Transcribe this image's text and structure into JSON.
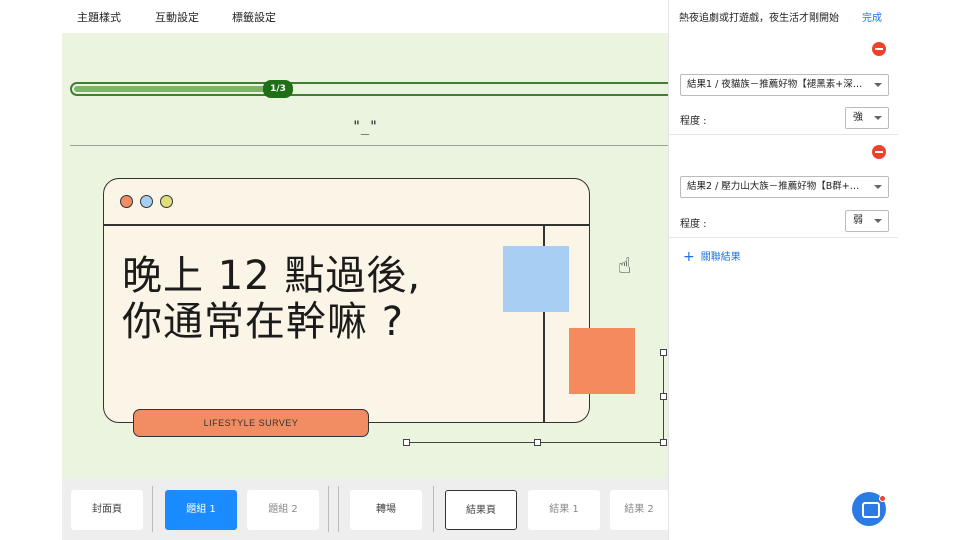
{
  "menu": {
    "items": [
      "主題樣式",
      "互動設定",
      "標籤設定"
    ]
  },
  "canvas": {
    "progress": {
      "label": "1/3",
      "fraction": 0.3333
    },
    "subtitle": "\"_\"",
    "headline_line1": "晚上 12 點過後,",
    "headline_line2": "你通常在幹嘛 ?",
    "pill_label": "LIFESTYLE SURVEY",
    "dot_colors": [
      "#f28c63",
      "#a8cef3",
      "#dede7a"
    ]
  },
  "pages": [
    {
      "label": "封面頁"
    },
    {
      "label": "題組 1"
    },
    {
      "label": "題組 2"
    },
    {
      "label": "轉場"
    },
    {
      "label": "結果頁"
    },
    {
      "label": "結果 1"
    },
    {
      "label": "結果 2"
    }
  ],
  "panel": {
    "title": "熱夜追劇或打遊戲，夜生活才剛開始",
    "done_label": "完成",
    "results": [
      {
        "result_value": "結果1 / 夜貓族－推薦好物【褪黑素+深…",
        "degree_label": "程度 :",
        "degree_value": "強"
      },
      {
        "result_value": "結果2 / 壓力山大族－推薦好物【B群+…",
        "degree_label": "程度 :",
        "degree_value": "弱"
      }
    ],
    "add_label": "關聯結果"
  },
  "colors": {
    "accent": "#1a8cff",
    "canvas_bg": "#eaf4df",
    "progress": "#3f7f2f",
    "remove": "#f0412d"
  }
}
